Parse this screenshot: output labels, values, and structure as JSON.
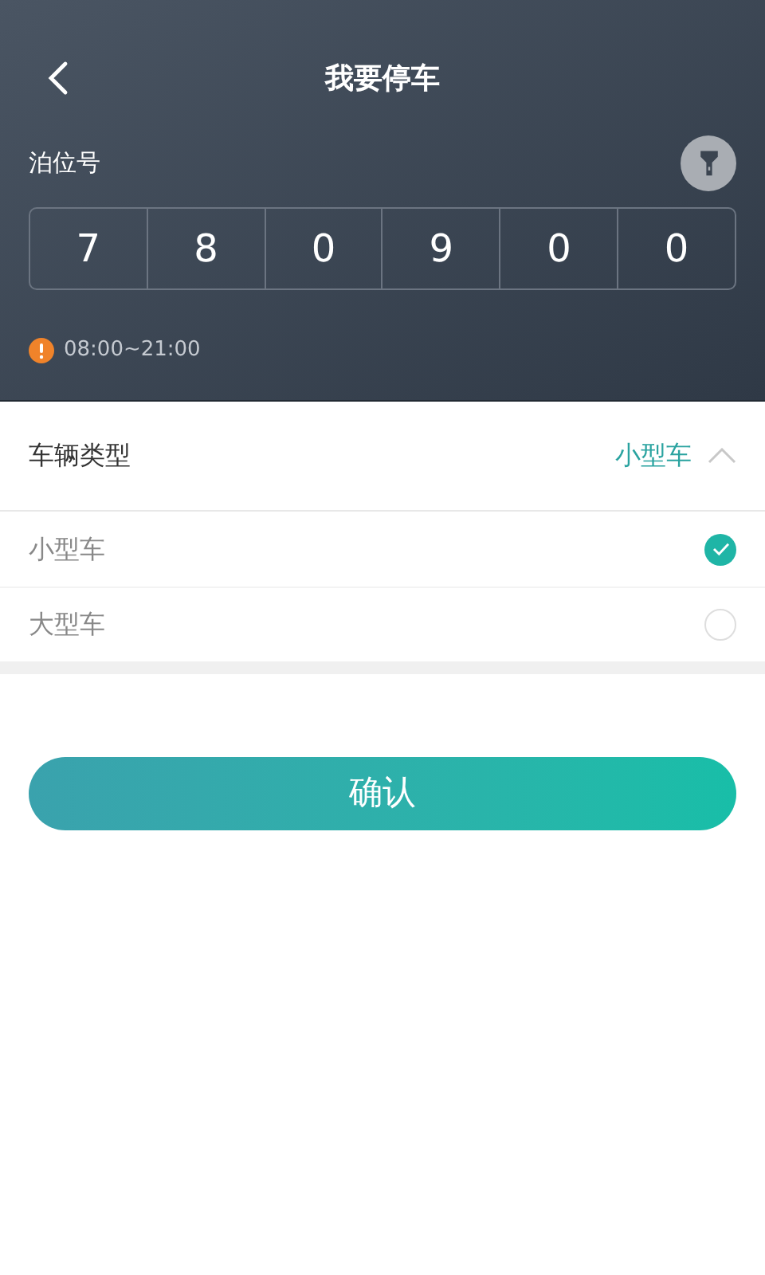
{
  "header": {
    "title": "我要停车"
  },
  "berth": {
    "label": "泊位号",
    "digits": [
      "7",
      "8",
      "0",
      "9",
      "0",
      "0"
    ],
    "hours": "08:00~21:00"
  },
  "vehicle_type": {
    "label": "车辆类型",
    "value": "小型车",
    "expanded": true,
    "options": [
      {
        "label": "小型车",
        "selected": true
      },
      {
        "label": "大型车",
        "selected": false
      }
    ]
  },
  "confirm_button": "确认"
}
